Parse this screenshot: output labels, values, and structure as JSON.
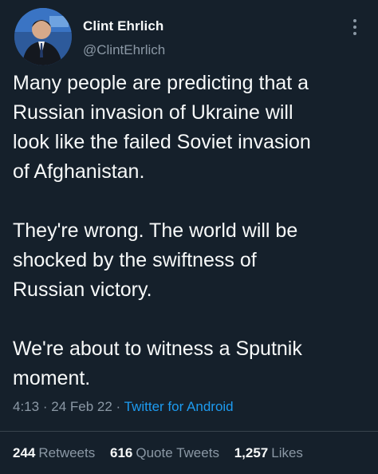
{
  "author": {
    "name": "Clint Ehrlich",
    "handle": "@ClintEhrlich"
  },
  "tweet": {
    "paragraphs": [
      "Many people are predicting that a\nRussian invasion of Ukraine will\nlook like the failed Soviet invasion\nof Afghanistan.",
      "They're wrong. The world will be\nshocked by the swiftness of\nRussian victory.",
      "We're about to witness a Sputnik\nmoment."
    ],
    "time": "4:13",
    "separator": "·",
    "date": "24 Feb 22",
    "source": "Twitter for Android"
  },
  "stats": {
    "retweets_count": "244",
    "retweets_label": "Retweets",
    "quotes_count": "616",
    "quotes_label": "Quote Tweets",
    "likes_count": "1,257",
    "likes_label": "Likes"
  },
  "icons": {
    "more": "more-vertical-icon"
  },
  "colors": {
    "background": "#15202b",
    "text": "#f7f9f9",
    "secondary": "#8b98a5",
    "link": "#1d9bf0",
    "divider": "#38444d"
  }
}
